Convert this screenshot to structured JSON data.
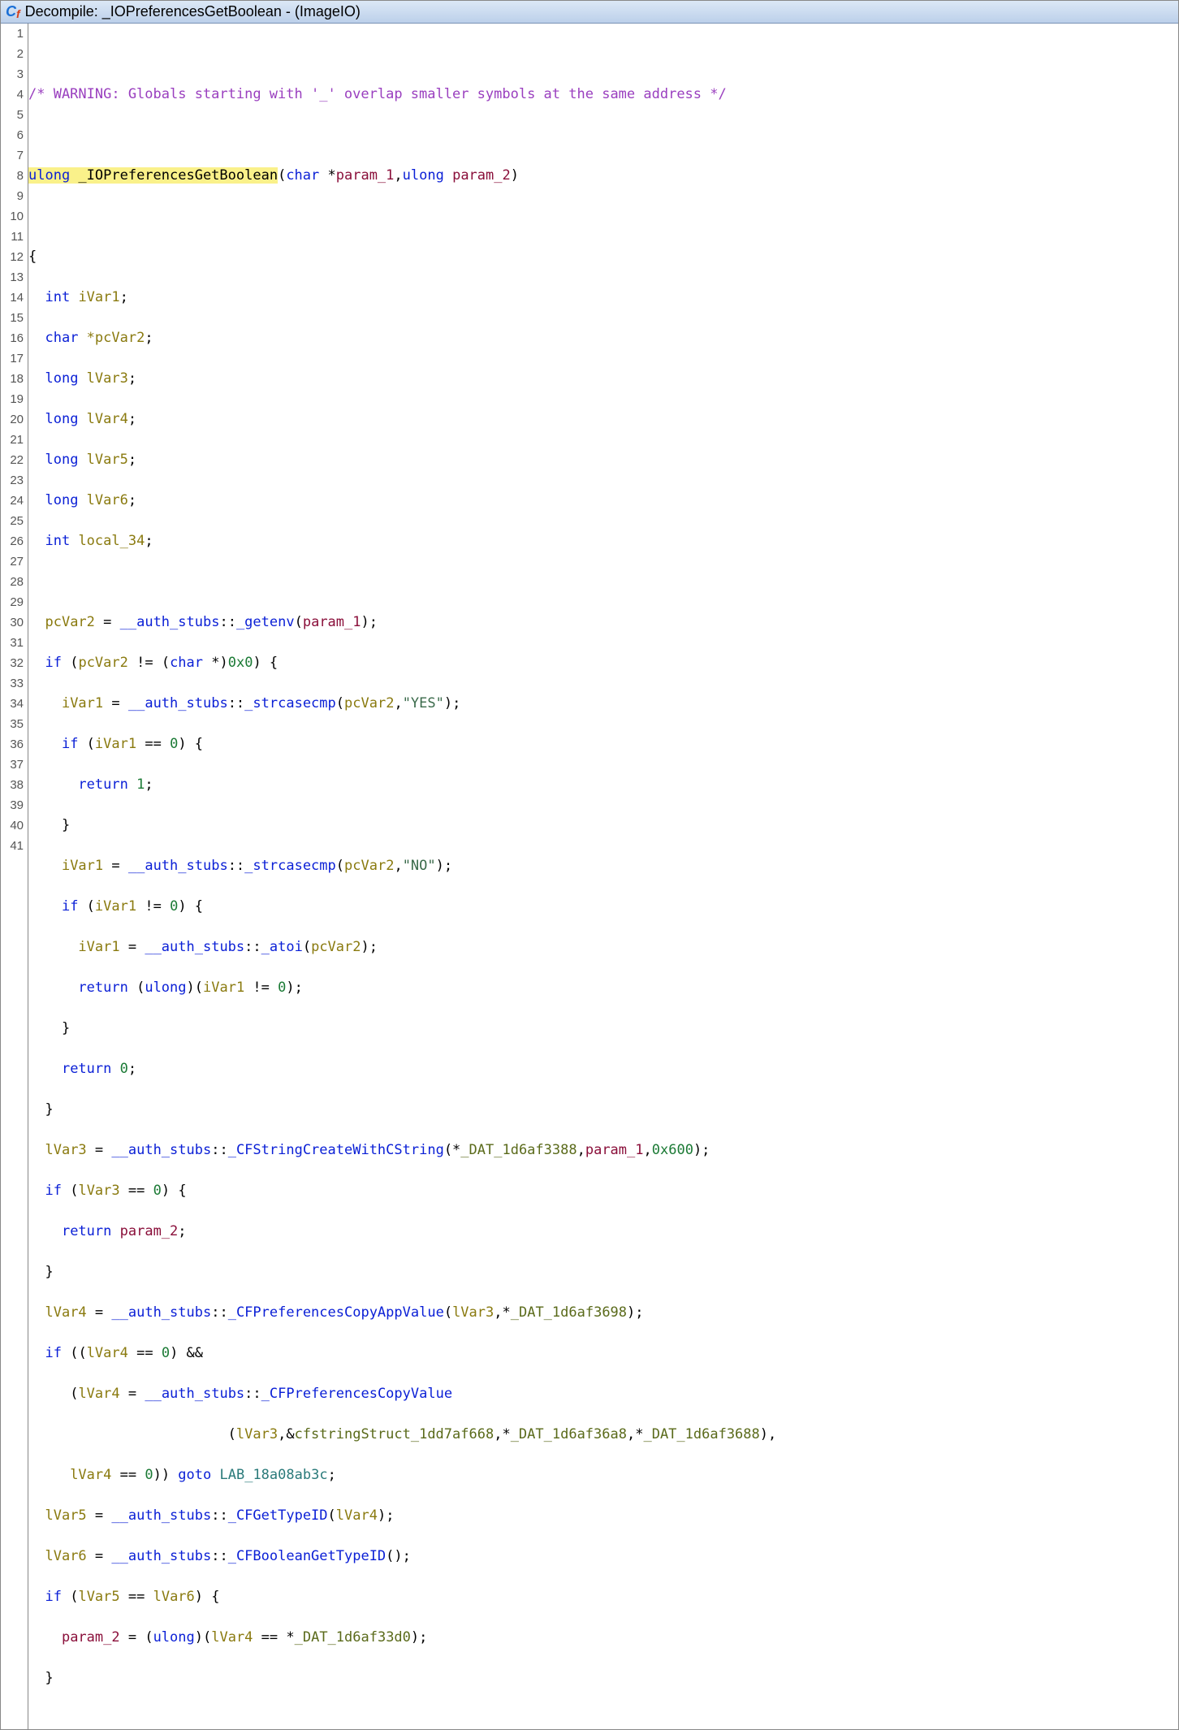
{
  "titlebar": {
    "prefix": "Decompile: ",
    "func": "_IOPreferencesGetBoolean",
    "suffix": " -  (ImageIO)"
  },
  "code": {
    "commentWarning": "/* WARNING: Globals starting with '_' overlap smaller symbols at the same address */",
    "sigType": "ulong",
    "sigName": " _IOPreferencesGetBoolean",
    "sigParams_open": "(",
    "sigP1Type": "char",
    "sigP1Ptr": " *",
    "sigP1Name": "param_1",
    "sigComma": ",",
    "sigP2Type": "ulong",
    "sigP2Name": " param_2",
    "sigParams_close": ")",
    "decl_int": "int",
    "decl_char": "char",
    "decl_long": "long",
    "var_iVar1": " iVar1",
    "var_pcVar2": "pcVar2",
    "var_pcVar2_decl": " *pcVar2",
    "var_lVar3": " lVar3",
    "var_lVar4": " lVar4",
    "var_lVar5": " lVar5",
    "var_lVar6": " lVar6",
    "var_local34": " local_34",
    "auth_stubs": "__auth_stubs",
    "dc": "::",
    "fn_getenv": "_getenv",
    "fn_strcasecmp": "_strcasecmp",
    "fn_atoi": "_atoi",
    "fn_CFStringCreate": "_CFStringCreateWithCString",
    "fn_CFPrefCopyApp": "_CFPreferencesCopyAppValue",
    "fn_CFPrefCopyVal": "_CFPreferencesCopyValue",
    "fn_CFGetTypeID": "_CFGetTypeID",
    "fn_CFBoolTypeID": "_CFBooleanGetTypeID",
    "param1": "param_1",
    "param2": "param_2",
    "iVar1": "iVar1",
    "lVar3": "lVar3",
    "lVar4": "lVar4",
    "lVar5": "lVar5",
    "lVar6": "lVar6",
    "strYES": "\"YES\"",
    "strNO": "\"NO\"",
    "zero": "0",
    "one": "1",
    "hex0x0": "0x0",
    "hex0x600": "0x600",
    "kw_if": "if",
    "kw_return": "return",
    "kw_goto": "goto",
    "dat3388": "_DAT_1d6af3388",
    "dat3698": "_DAT_1d6af3698",
    "dat36a8": "_DAT_1d6af36a8",
    "dat3688": "_DAT_1d6af3688",
    "dat33d0": "_DAT_1d6af33d0",
    "cfstringStruct": "cfstringStruct_1dd7af668",
    "label": "LAB_18a08ab3c",
    "cast_char": "char",
    "cast_ulong": "ulong"
  },
  "lineNumbers": [
    "1",
    "2",
    "3",
    "4",
    "5",
    "6",
    "7",
    "8",
    "9",
    "10",
    "11",
    "12",
    "13",
    "14",
    "15",
    "16",
    "17",
    "18",
    "19",
    "20",
    "21",
    "22",
    "23",
    "24",
    "25",
    "26",
    "27",
    "28",
    "29",
    "30",
    "31",
    "32",
    "33",
    "34",
    "35",
    "36",
    "37",
    "38",
    "39",
    "40",
    "41"
  ]
}
